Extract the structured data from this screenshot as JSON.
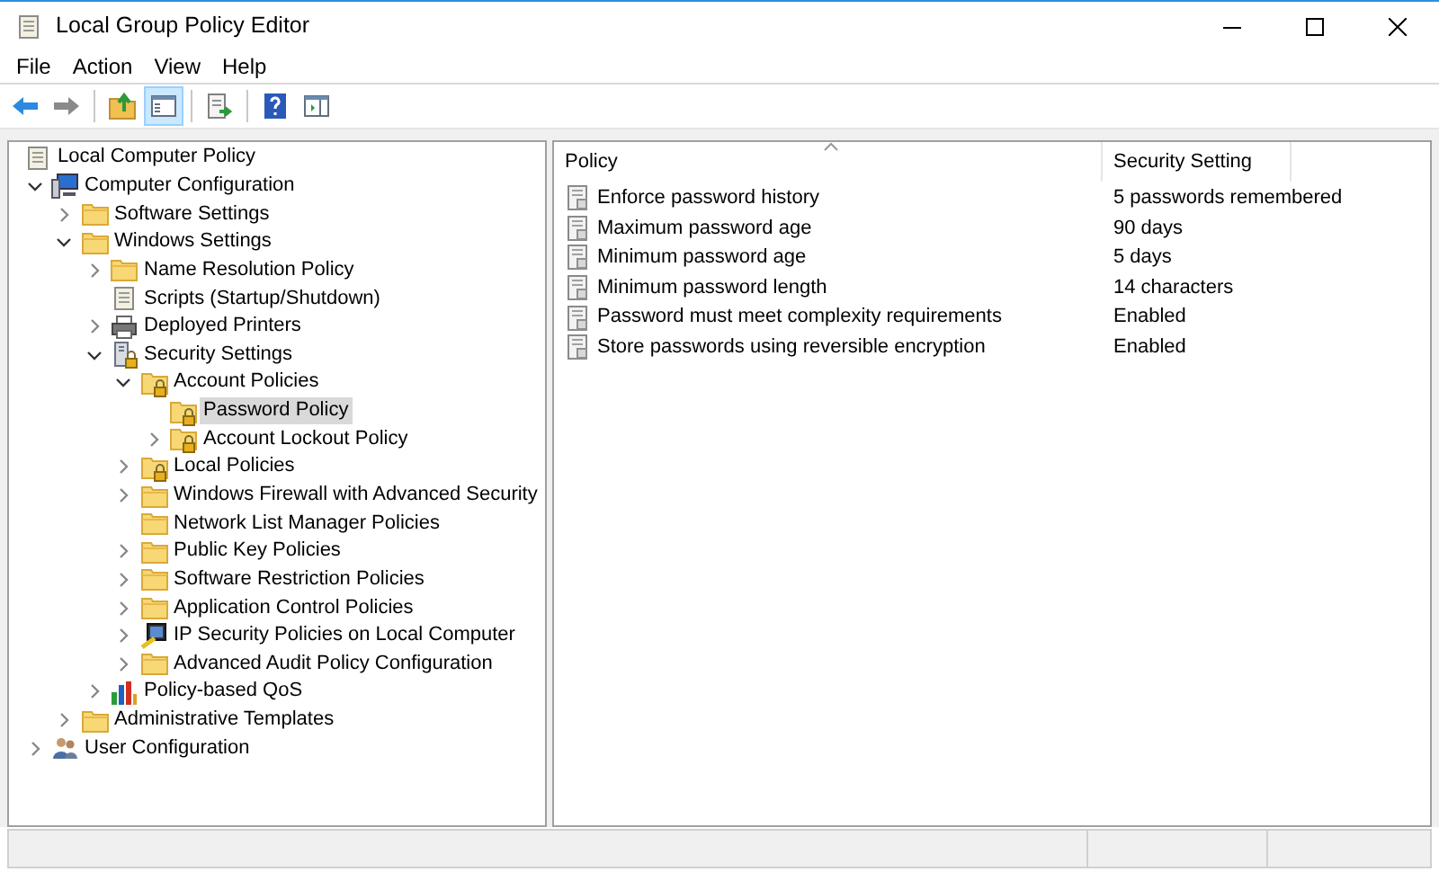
{
  "window": {
    "title": "Local Group Policy Editor"
  },
  "menu": [
    "File",
    "Action",
    "View",
    "Help"
  ],
  "toolbar": [
    {
      "kind": "back",
      "pressed": false
    },
    {
      "kind": "forward",
      "pressed": false
    },
    {
      "kind": "up",
      "pressed": false
    },
    {
      "kind": "tree",
      "pressed": true
    },
    {
      "kind": "export",
      "pressed": false
    },
    {
      "kind": "help",
      "pressed": false
    },
    {
      "kind": "pane",
      "pressed": false
    }
  ],
  "tree": {
    "label": "Local Computer Policy",
    "kind": "script",
    "children": [
      {
        "label": "Computer Configuration",
        "kind": "computer",
        "expanded": true,
        "selected": false,
        "children": [
          {
            "label": "Software Settings",
            "kind": "folder",
            "expanded": false,
            "selected": false
          },
          {
            "label": "Windows Settings",
            "kind": "folder",
            "expanded": true,
            "selected": false,
            "children": [
              {
                "label": "Name Resolution Policy",
                "kind": "folder",
                "expanded": false,
                "selected": false
              },
              {
                "label": "Scripts (Startup/Shutdown)",
                "kind": "script",
                "selected": false
              },
              {
                "label": "Deployed Printers",
                "kind": "printer",
                "expanded": false,
                "selected": false
              },
              {
                "label": "Security Settings",
                "kind": "security",
                "expanded": true,
                "selected": false,
                "children": [
                  {
                    "label": "Account Policies",
                    "kind": "folder-lock",
                    "expanded": true,
                    "selected": false,
                    "children": [
                      {
                        "label": "Password Policy",
                        "kind": "folder-lock",
                        "selected": true
                      },
                      {
                        "label": "Account Lockout Policy",
                        "kind": "folder-lock",
                        "expanded": false,
                        "selected": false
                      }
                    ]
                  },
                  {
                    "label": "Local Policies",
                    "kind": "folder-lock",
                    "expanded": false,
                    "selected": false
                  },
                  {
                    "label": "Windows Firewall with Advanced Security",
                    "kind": "folder",
                    "expanded": false,
                    "selected": false
                  },
                  {
                    "label": "Network List Manager Policies",
                    "kind": "folder",
                    "selected": false
                  },
                  {
                    "label": "Public Key Policies",
                    "kind": "folder",
                    "expanded": false,
                    "selected": false
                  },
                  {
                    "label": "Software Restriction Policies",
                    "kind": "folder",
                    "expanded": false,
                    "selected": false
                  },
                  {
                    "label": "Application Control Policies",
                    "kind": "folder",
                    "expanded": false,
                    "selected": false
                  },
                  {
                    "label": "IP Security Policies on Local Computer",
                    "kind": "ipsec",
                    "expanded": false,
                    "selected": false
                  },
                  {
                    "label": "Advanced Audit Policy Configuration",
                    "kind": "folder",
                    "expanded": false,
                    "selected": false
                  }
                ]
              },
              {
                "label": "Policy-based QoS",
                "kind": "chart",
                "expanded": false,
                "selected": false
              }
            ]
          },
          {
            "label": "Administrative Templates",
            "kind": "folder",
            "expanded": false,
            "selected": false
          }
        ]
      },
      {
        "label": "User Configuration",
        "kind": "user",
        "expanded": false,
        "selected": false
      }
    ]
  },
  "table": {
    "columns": [
      "Policy",
      "Security Setting"
    ],
    "rows": [
      {
        "policy": "Enforce password history",
        "setting": "5 passwords remembered"
      },
      {
        "policy": "Maximum password age",
        "setting": "90 days"
      },
      {
        "policy": "Minimum password age",
        "setting": "5 days"
      },
      {
        "policy": "Minimum password length",
        "setting": "14 characters"
      },
      {
        "policy": "Password must meet complexity requirements",
        "setting": "Enabled"
      },
      {
        "policy": "Store passwords using reversible encryption",
        "setting": "Enabled"
      }
    ]
  }
}
